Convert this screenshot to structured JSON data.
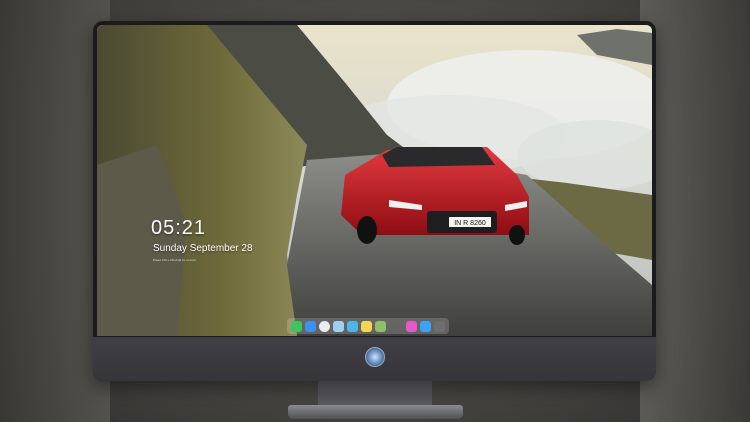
{
  "lock_screen": {
    "time": "05:21",
    "date": "Sunday September 28",
    "subline": "Press Ctrl+Alt+Del to unlock"
  },
  "car": {
    "plate": "IN R 8260"
  },
  "dock": {
    "icons": [
      {
        "name": "messages-icon",
        "color": "#3fc35a"
      },
      {
        "name": "finder-icon",
        "color": "#3d8ff0"
      },
      {
        "name": "safari-icon",
        "color": "#e9edf2"
      },
      {
        "name": "photos-icon",
        "color": "#9fcff0"
      },
      {
        "name": "clapper-icon",
        "color": "#4ab7e8"
      },
      {
        "name": "notes-icon",
        "color": "#f6d552"
      },
      {
        "name": "preview-icon",
        "color": "#8fbf6a"
      },
      {
        "name": "itunes-icon",
        "color": "#e458c7"
      },
      {
        "name": "appstore-icon",
        "color": "#3ba4f6"
      },
      {
        "name": "camera-icon",
        "color": "#6d6d72"
      }
    ]
  },
  "colors": {
    "car_red": "#c8171f",
    "monitor_frame": "#1b1b1d",
    "monitor_chin": "#3a3a40"
  }
}
